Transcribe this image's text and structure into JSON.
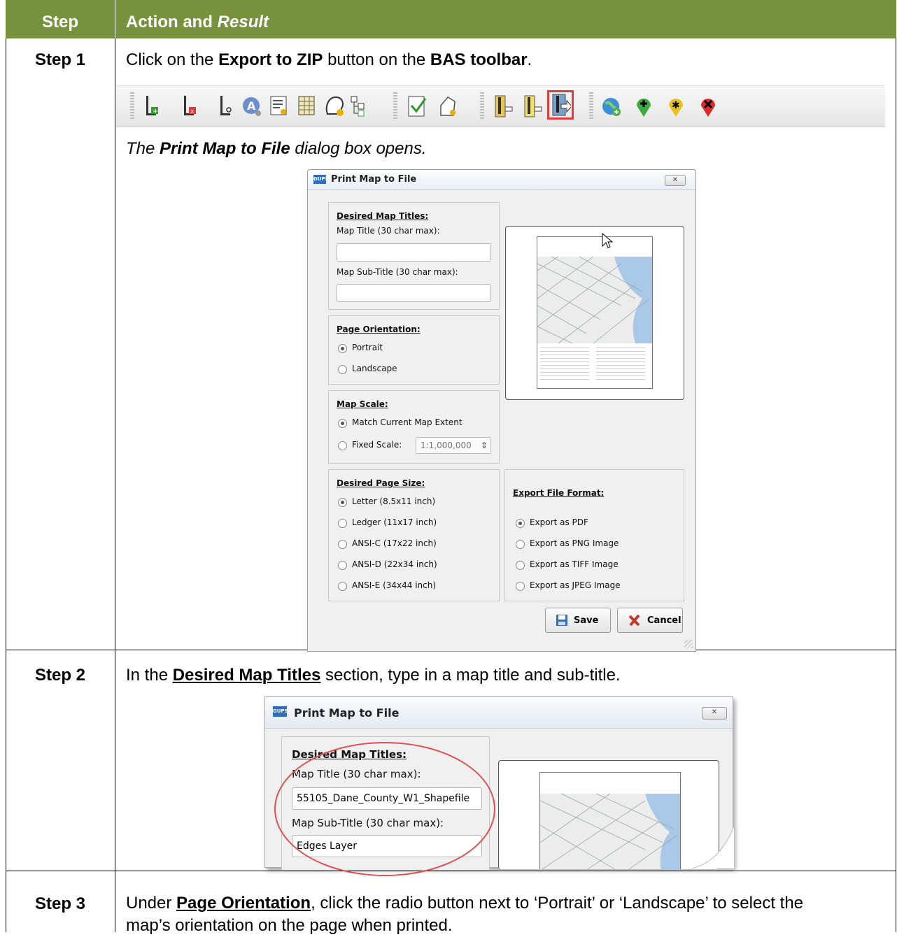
{
  "header": {
    "step_col": "Step",
    "action_col": "Action and ",
    "result_word": "Result"
  },
  "steps": [
    {
      "label": "Step 1",
      "text": {
        "pre": "Click on the ",
        "b1": "Export to ZIP",
        "mid": " button on the ",
        "b2": "BAS toolbar",
        "post": "."
      },
      "result": {
        "pre": "The ",
        "b": "Print Map to File",
        "post": " dialog box opens."
      }
    },
    {
      "label": "Step 2",
      "text": {
        "pre": "In the ",
        "u": "Desired Map Titles",
        "post": " section, type in a map title and sub-title."
      }
    },
    {
      "label": "Step 3",
      "text": {
        "pre": "Under ",
        "u": "Page Orientation",
        "mid": ", click the radio button next to ‘Portrait’ or ‘Landscape’ to select the",
        "line2": "map’s orientation on the page when printed."
      }
    }
  ],
  "toolbar": {
    "icons": [
      "add-edge-icon",
      "delete-edge-icon",
      "split-edge-icon",
      "annotation-icon",
      "form-icon",
      "table-icon",
      "head-icon",
      "tree-icon",
      "check-icon",
      "shape-icon",
      "zip-import-icon",
      "zip-import-2-icon",
      "export-to-zip-icon",
      "globe-add-icon",
      "add-marker-icon",
      "star-marker-icon",
      "delete-marker-icon"
    ],
    "highlight_color": "#e03c3c"
  },
  "dialog": {
    "title": "Print Map to File",
    "logo": "GUPS",
    "close": "✕",
    "titles_group": "Desired Map Titles:",
    "map_title_label": "Map Title (30 char max):",
    "map_subtitle_label": "Map Sub-Title (30 char max):",
    "orientation_group": "Page Orientation:",
    "portrait": "Portrait",
    "landscape": "Landscape",
    "scale_group": "Map Scale:",
    "match_extent": "Match Current Map Extent",
    "fixed_scale": "Fixed Scale:",
    "fixed_scale_value": "1:1,000,000",
    "page_size_group": "Desired Page Size:",
    "sizes": [
      "Letter (8.5x11 inch)",
      "Ledger (11x17 inch)",
      "ANSI-C (17x22 inch)",
      "ANSI-D (22x34 inch)",
      "ANSI-E (34x44 inch)"
    ],
    "format_group": "Export File Format:",
    "formats": [
      "Export as PDF",
      "Export as PNG Image",
      "Export as TIFF Image",
      "Export as JPEG Image"
    ],
    "save": "Save",
    "cancel": "Cancel"
  },
  "dialog2": {
    "title": "Print Map to File",
    "titles_group": "Desired Map Titles:",
    "map_title_label": "Map Title (30 char max):",
    "map_title_value": "55105_Dane_County_W1_Shapefile",
    "map_subtitle_label": "Map Sub-Title (30 char max):",
    "map_subtitle_value": "Edges Layer"
  }
}
